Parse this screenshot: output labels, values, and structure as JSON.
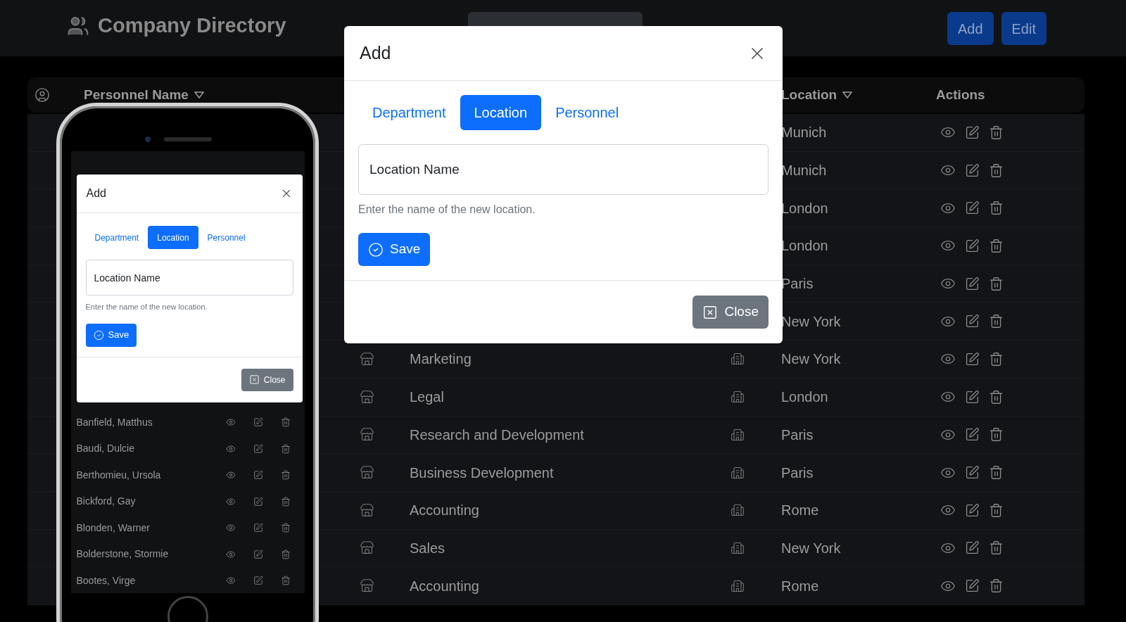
{
  "header": {
    "title": "Company Directory",
    "buttons": [
      "Add",
      "Edit"
    ]
  },
  "table": {
    "columns": {
      "personnel": "Personnel Name",
      "location": "Location",
      "actions": "Actions"
    },
    "rows": [
      {
        "location": "Munich"
      },
      {
        "location": "Munich"
      },
      {
        "location": "London"
      },
      {
        "location": "London"
      },
      {
        "location": "Paris"
      },
      {
        "location": "New York"
      },
      {
        "department": "Marketing",
        "location": "New York"
      },
      {
        "department": "Legal",
        "location": "London"
      },
      {
        "department": "Research and Development",
        "location": "Paris"
      },
      {
        "department": "Business Development",
        "location": "Paris"
      },
      {
        "department": "Accounting",
        "location": "Rome"
      },
      {
        "department": "Sales",
        "location": "New York"
      },
      {
        "department": "Accounting",
        "location": "Rome"
      }
    ]
  },
  "modal": {
    "title": "Add",
    "tabs": [
      {
        "label": "Department",
        "selected": false
      },
      {
        "label": "Location",
        "selected": true
      },
      {
        "label": "Personnel",
        "selected": false
      }
    ],
    "placeholder": "Location Name",
    "help": "Enter the name of the new location.",
    "save": "Save",
    "close": "Close"
  },
  "phone": {
    "modal": {
      "title": "Add",
      "tabs": [
        {
          "label": "Department",
          "selected": false
        },
        {
          "label": "Location",
          "selected": true
        },
        {
          "label": "Personnel",
          "selected": false
        }
      ],
      "placeholder": "Location Name",
      "help": "Enter the name of the new location.",
      "save": "Save",
      "close": "Close"
    },
    "rows": [
      {
        "name": "Banfield, Matthus"
      },
      {
        "name": "Baudi, Dulcie"
      },
      {
        "name": "Berthomieu, Ursola"
      },
      {
        "name": "Bickford, Gay"
      },
      {
        "name": "Blonden, Warner"
      },
      {
        "name": "Bolderstone, Stormie"
      },
      {
        "name": "Bootes, Virge"
      }
    ]
  }
}
